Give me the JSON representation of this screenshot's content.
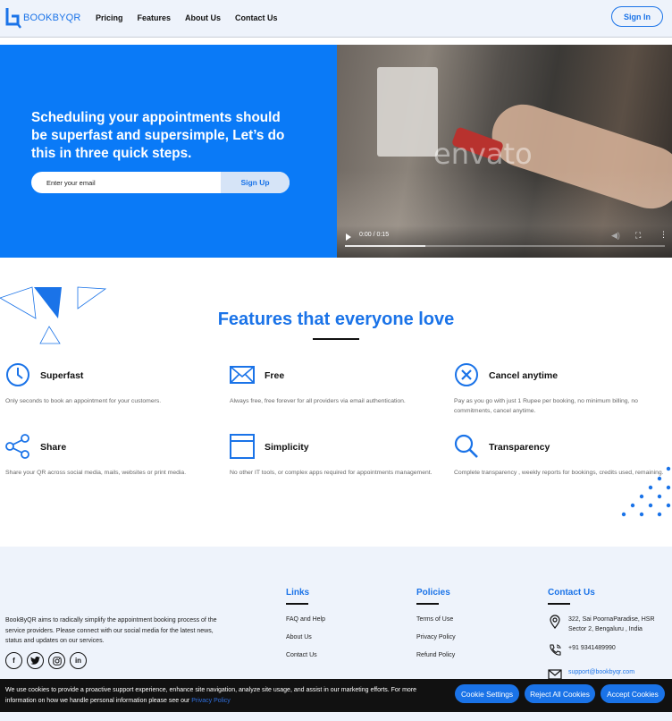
{
  "header": {
    "logo_text": "BOOKBYQR",
    "nav": [
      "Pricing",
      "Features",
      "About Us",
      "Contact Us"
    ],
    "signin_label": "Sign In"
  },
  "hero": {
    "title": "Scheduling your appointments should be superfast and supersimple, Let’s do this in three quick steps.",
    "email_placeholder": "Enter your email",
    "signup_label": "Sign Up"
  },
  "video": {
    "watermark": "envato",
    "time": "0:00 / 0:15",
    "progress": 0.25
  },
  "features": {
    "title": "Features that everyone love",
    "items": [
      {
        "title": "Superfast",
        "desc": "Only seconds to book an appointment for your customers.",
        "icon": "clock-icon"
      },
      {
        "title": "Free",
        "desc": "Always free, free forever for all providers via email authentication.",
        "icon": "envelope-icon"
      },
      {
        "title": "Cancel anytime",
        "desc": "Pay as you go with just 1 Rupee per booking, no minimum billing, no commitments, cancel anytime.",
        "icon": "cancel-circle-icon"
      },
      {
        "title": "Share",
        "desc": "Share your QR across social media, mails, websites or print media.",
        "icon": "share-icon"
      },
      {
        "title": "Simplicity",
        "desc": "No other IT tools, or complex apps required for appointments management.",
        "icon": "window-icon"
      },
      {
        "title": "Transparency",
        "desc": "Complete transparency , weekly reports for bookings, credits used, remaining.",
        "icon": "search-icon"
      }
    ]
  },
  "footer": {
    "about": "BookByQR aims to radically simplify the appointment booking process of the service providers. Please connect with our social media for the latest news, status and updates on our services.",
    "socials": [
      "f",
      "t",
      "ig",
      "in"
    ],
    "links": {
      "title": "Links",
      "items": [
        "FAQ and Help",
        "About Us",
        "Contact Us"
      ]
    },
    "policies": {
      "title": "Policies",
      "items": [
        "Terms of Use",
        "Privacy Policy",
        "Refund Policy"
      ]
    },
    "contact": {
      "title": "Contact Us",
      "address": "322, Sai PoornaParadise, HSR Sector 2, Bengaluru , India",
      "phone": "+91 9341489990",
      "email": "support@bookbyqr.com"
    }
  },
  "cookie": {
    "text": "We use cookies to provide a proactive support experience, enhance site navigation, analyze site usage, and assist in our marketing efforts. For more information on how we handle personal information please see our ",
    "link": "Privacy Policy",
    "settings_label": "Cookie Settings",
    "reject_label": "Reject All Cookies",
    "accept_label": "Accept Cookies"
  },
  "colors": {
    "accent": "#1a73e8",
    "hero_bg": "#0a7af7",
    "footer_bg": "#eef3fb",
    "cookie_bg": "#111111"
  }
}
